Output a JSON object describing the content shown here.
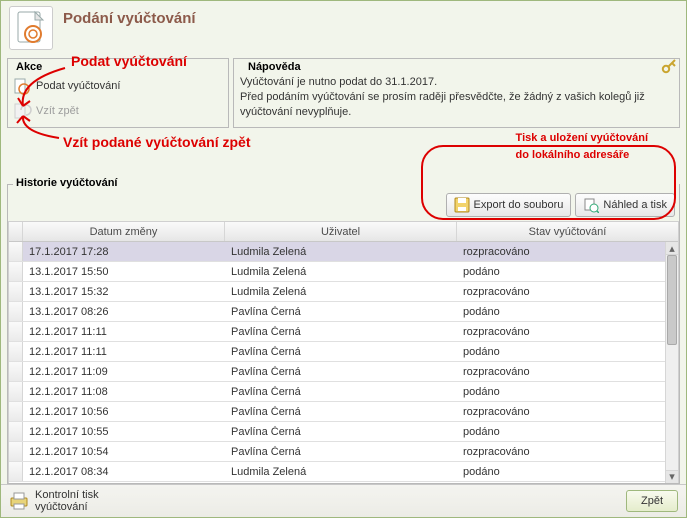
{
  "header": {
    "title": "Podání vyúčtování"
  },
  "annotations": {
    "podat": "Podat vyúčtování",
    "vzit_zpet": "Vzít podané vyúčtování zpět",
    "tisk_line1": "Tisk a uložení vyúčtování",
    "tisk_line2": "do lokálního adresáře"
  },
  "akce": {
    "title": "Akce",
    "items": [
      {
        "label": "Podat vyúčtování",
        "disabled": false
      },
      {
        "label": "Vzít zpět",
        "disabled": true
      }
    ]
  },
  "help": {
    "title": "Nápověda",
    "line1": "Vyúčtování je nutno podat do 31.1.2017.",
    "line2": "Před podáním vyúčtování se prosím raději přesvědčte, že žádný z vašich kolegů již vyúčtování nevyplňuje."
  },
  "history": {
    "title": "Historie vyúčtování",
    "buttons": {
      "export": "Export do souboru",
      "print": "Náhled a tisk"
    },
    "columns": {
      "date": "Datum změny",
      "user": "Uživatel",
      "state": "Stav vyúčtování"
    },
    "rows": [
      {
        "date": "17.1.2017 17:28",
        "user": "Ludmila Zelená",
        "state": "rozpracováno",
        "selected": true
      },
      {
        "date": "13.1.2017 15:50",
        "user": "Ludmila Zelená",
        "state": "podáno"
      },
      {
        "date": "13.1.2017 15:32",
        "user": "Ludmila Zelená",
        "state": "rozpracováno"
      },
      {
        "date": "13.1.2017 08:26",
        "user": "Pavlína Černá",
        "state": "podáno"
      },
      {
        "date": "12.1.2017 11:11",
        "user": "Pavlína Černá",
        "state": "rozpracováno"
      },
      {
        "date": "12.1.2017 11:11",
        "user": "Pavlína Černá",
        "state": "podáno"
      },
      {
        "date": "12.1.2017 11:09",
        "user": "Pavlína Černá",
        "state": "rozpracováno"
      },
      {
        "date": "12.1.2017 11:08",
        "user": "Pavlína Černá",
        "state": "podáno"
      },
      {
        "date": "12.1.2017 10:56",
        "user": "Pavlína Černá",
        "state": "rozpracováno"
      },
      {
        "date": "12.1.2017 10:55",
        "user": "Pavlína Černá",
        "state": "podáno"
      },
      {
        "date": "12.1.2017 10:54",
        "user": "Pavlína Černá",
        "state": "rozpracováno"
      },
      {
        "date": "12.1.2017 08:34",
        "user": "Ludmila Zelená",
        "state": "podáno"
      }
    ]
  },
  "footer": {
    "left": "Kontrolní tisk vyúčtování",
    "back": "Zpět"
  }
}
